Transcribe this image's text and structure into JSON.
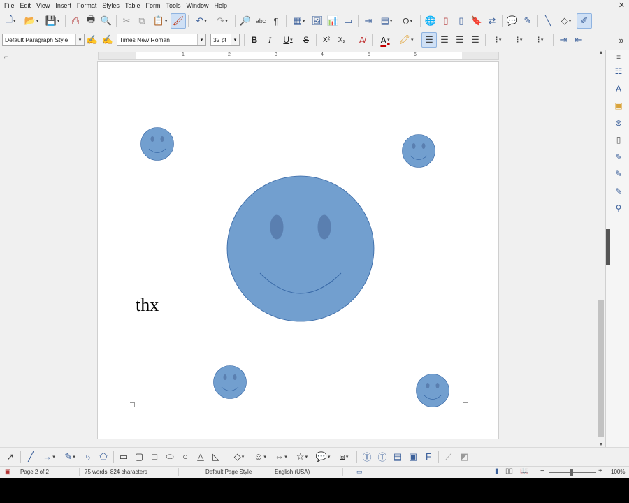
{
  "menu": [
    "File",
    "Edit",
    "View",
    "Insert",
    "Format",
    "Styles",
    "Table",
    "Form",
    "Tools",
    "Window",
    "Help"
  ],
  "formatting": {
    "paragraph_style": "Default Paragraph Style",
    "font_name": "Times New Roman",
    "font_size": "32 pt",
    "bold": "B",
    "italic": "I",
    "underline": "U",
    "strikethrough": "S",
    "superscript": "X²",
    "subscript": "X₂"
  },
  "ruler": {
    "labels": [
      "1",
      "2",
      "3",
      "4",
      "5",
      "6"
    ]
  },
  "document": {
    "text": "thx"
  },
  "status": {
    "page": "Page 2 of 2",
    "words": "75 words, 824 characters",
    "page_style": "Default Page Style",
    "language": "English (USA)",
    "zoom": "100%",
    "zoom_minus": "−",
    "zoom_plus": "+"
  },
  "colors": {
    "smiley_fill": "#729fcf",
    "smiley_stroke": "#3465a4",
    "eye": "#5a7fb0",
    "accent": "#3a5f9a"
  }
}
